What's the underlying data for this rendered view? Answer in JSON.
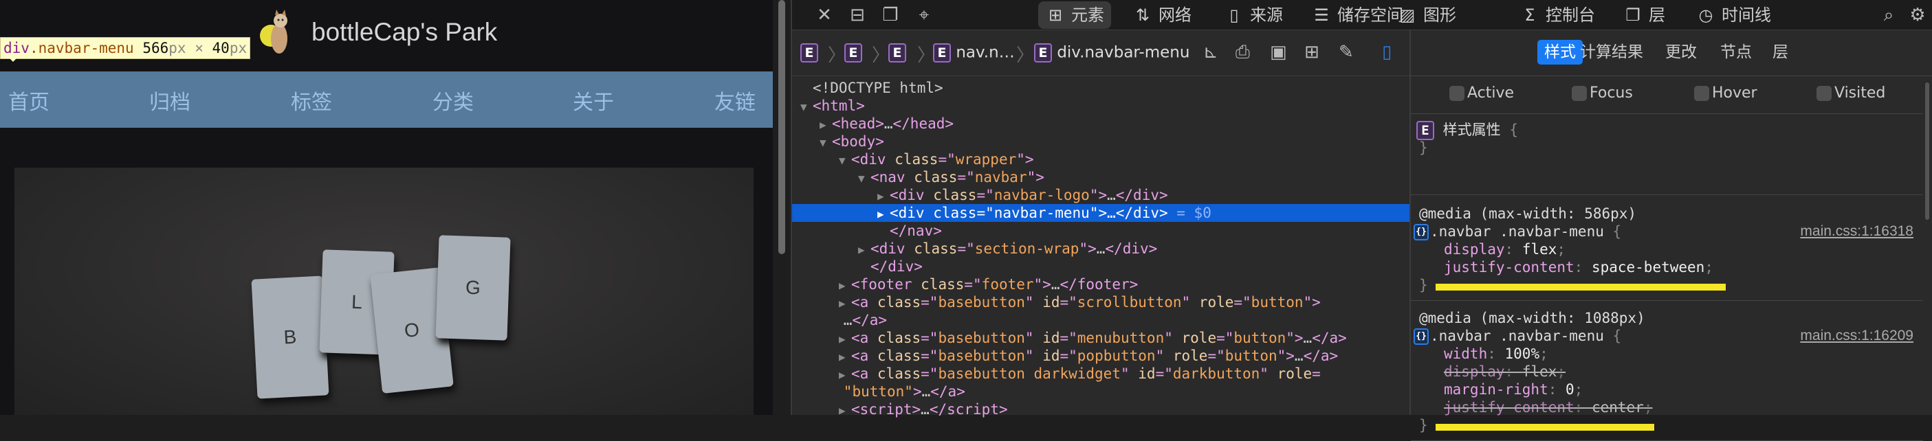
{
  "site": {
    "title": "bottleCap's Park",
    "nav": [
      "首页",
      "归档",
      "标签",
      "分类",
      "关于",
      "友链"
    ],
    "hero_letters": [
      "B",
      "L",
      "O",
      "G"
    ]
  },
  "tooltip": {
    "tag": "div",
    "cls": ".navbar-menu",
    "w": "566",
    "h": "40",
    "unit": "px",
    "times": "×"
  },
  "devtools": {
    "tabs": [
      {
        "label": "元素",
        "icon": "elements-icon"
      },
      {
        "label": "网络",
        "icon": "network-icon"
      },
      {
        "label": "来源",
        "icon": "sources-icon"
      },
      {
        "label": "储存空间",
        "icon": "storage-icon"
      },
      {
        "label": "图形",
        "icon": "graphics-icon"
      },
      {
        "label": "控制台",
        "icon": "console-icon"
      },
      {
        "label": "层",
        "icon": "layers-icon"
      },
      {
        "label": "时间线",
        "icon": "timeline-icon"
      }
    ],
    "active_tab": "元素",
    "breadcrumb": [
      "",
      "",
      "",
      "nav.n…",
      "div.navbar-menu"
    ],
    "dom": [
      [
        0,
        "",
        [
          [
            "t-txt",
            "<!DOCTYPE html>"
          ]
        ]
      ],
      [
        0,
        "▼",
        [
          [
            "t-tag",
            "<html>"
          ]
        ]
      ],
      [
        1,
        "▶",
        [
          [
            "t-tag",
            "<head>"
          ],
          [
            "t-txt",
            "…"
          ],
          [
            "t-tag",
            "</head>"
          ]
        ]
      ],
      [
        1,
        "▼",
        [
          [
            "t-tag",
            "<body>"
          ]
        ]
      ],
      [
        2,
        "▼",
        [
          [
            "t-tag",
            "<div "
          ],
          [
            "t-attr",
            "class"
          ],
          [
            "t-tag",
            "=\""
          ],
          [
            "t-val",
            "wrapper"
          ],
          [
            "t-tag",
            "\">"
          ]
        ]
      ],
      [
        3,
        "▼",
        [
          [
            "t-tag",
            "<nav "
          ],
          [
            "t-attr",
            "class"
          ],
          [
            "t-tag",
            "=\""
          ],
          [
            "t-val",
            "navbar"
          ],
          [
            "t-tag",
            "\">"
          ]
        ]
      ],
      [
        4,
        "▶",
        [
          [
            "t-tag",
            "<div "
          ],
          [
            "t-attr",
            "class"
          ],
          [
            "t-tag",
            "=\""
          ],
          [
            "t-val",
            "navbar-logo"
          ],
          [
            "t-tag",
            "\">"
          ],
          [
            "t-txt",
            "…"
          ],
          [
            "t-tag",
            "</div>"
          ]
        ]
      ],
      [
        4,
        "▶",
        [
          [
            "t-tag",
            "<div "
          ],
          [
            "t-attr",
            "class"
          ],
          [
            "t-tag",
            "=\""
          ],
          [
            "t-val",
            "navbar-menu"
          ],
          [
            "t-tag",
            "\">"
          ],
          [
            "t-txt",
            "…"
          ],
          [
            "t-tag",
            "</div>"
          ],
          [
            "t-dim",
            " = $0"
          ]
        ]
      ],
      [
        4,
        "",
        [
          [
            "t-tag",
            "</nav>"
          ]
        ]
      ],
      [
        3,
        "▶",
        [
          [
            "t-tag",
            "<div "
          ],
          [
            "t-attr",
            "class"
          ],
          [
            "t-tag",
            "=\""
          ],
          [
            "t-val",
            "section-wrap"
          ],
          [
            "t-tag",
            "\">"
          ],
          [
            "t-txt",
            "…"
          ],
          [
            "t-tag",
            "</div>"
          ]
        ]
      ],
      [
        3,
        "",
        [
          [
            "t-tag",
            "</div>"
          ]
        ]
      ],
      [
        2,
        "▶",
        [
          [
            "t-tag",
            "<footer "
          ],
          [
            "t-attr",
            "class"
          ],
          [
            "t-tag",
            "=\""
          ],
          [
            "t-val",
            "footer"
          ],
          [
            "t-tag",
            "\">"
          ],
          [
            "t-txt",
            "…"
          ],
          [
            "t-tag",
            "</footer>"
          ]
        ]
      ],
      [
        2,
        "▶",
        [
          [
            "t-tag",
            "<a "
          ],
          [
            "t-attr",
            "class"
          ],
          [
            "t-tag",
            "=\""
          ],
          [
            "t-val",
            "basebutton"
          ],
          [
            "t-tag",
            "\" "
          ],
          [
            "t-attr",
            "id"
          ],
          [
            "t-tag",
            "=\""
          ],
          [
            "t-val",
            "scrollbutton"
          ],
          [
            "t-tag",
            "\" "
          ],
          [
            "t-attr",
            "role"
          ],
          [
            "t-tag",
            "=\""
          ],
          [
            "t-val",
            "button"
          ],
          [
            "t-tag",
            "\">"
          ]
        ]
      ],
      [
        1.6,
        "",
        [
          [
            "t-txt",
            "…"
          ],
          [
            "t-tag",
            "</a>"
          ]
        ]
      ],
      [
        2,
        "▶",
        [
          [
            "t-tag",
            "<a "
          ],
          [
            "t-attr",
            "class"
          ],
          [
            "t-tag",
            "=\""
          ],
          [
            "t-val",
            "basebutton"
          ],
          [
            "t-tag",
            "\" "
          ],
          [
            "t-attr",
            "id"
          ],
          [
            "t-tag",
            "=\""
          ],
          [
            "t-val",
            "menubutton"
          ],
          [
            "t-tag",
            "\" "
          ],
          [
            "t-attr",
            "role"
          ],
          [
            "t-tag",
            "=\""
          ],
          [
            "t-val",
            "button"
          ],
          [
            "t-tag",
            "\">"
          ],
          [
            "t-txt",
            "…"
          ],
          [
            "t-tag",
            "</a>"
          ]
        ]
      ],
      [
        2,
        "▶",
        [
          [
            "t-tag",
            "<a "
          ],
          [
            "t-attr",
            "class"
          ],
          [
            "t-tag",
            "=\""
          ],
          [
            "t-val",
            "basebutton"
          ],
          [
            "t-tag",
            "\" "
          ],
          [
            "t-attr",
            "id"
          ],
          [
            "t-tag",
            "=\""
          ],
          [
            "t-val",
            "popbutton"
          ],
          [
            "t-tag",
            "\" "
          ],
          [
            "t-attr",
            "role"
          ],
          [
            "t-tag",
            "=\""
          ],
          [
            "t-val",
            "button"
          ],
          [
            "t-tag",
            "\">"
          ],
          [
            "t-txt",
            "…"
          ],
          [
            "t-tag",
            "</a>"
          ]
        ]
      ],
      [
        2,
        "▶",
        [
          [
            "t-tag",
            "<a "
          ],
          [
            "t-attr",
            "class"
          ],
          [
            "t-tag",
            "=\""
          ],
          [
            "t-val",
            "basebutton darkwidget"
          ],
          [
            "t-tag",
            "\" "
          ],
          [
            "t-attr",
            "id"
          ],
          [
            "t-tag",
            "=\""
          ],
          [
            "t-val",
            "darkbutton"
          ],
          [
            "t-tag",
            "\" "
          ],
          [
            "t-attr",
            "role"
          ],
          [
            "t-tag",
            "="
          ]
        ]
      ],
      [
        1.6,
        "",
        [
          [
            "t-val",
            "\"button\""
          ],
          [
            "t-tag",
            ">"
          ],
          [
            "t-txt",
            "…"
          ],
          [
            "t-tag",
            "</a>"
          ]
        ]
      ],
      [
        2,
        "▶",
        [
          [
            "t-tag",
            "<script>"
          ],
          [
            "t-txt",
            "…"
          ],
          [
            "t-tag",
            "</script>"
          ]
        ]
      ]
    ],
    "selected_index": 7,
    "sidebar": {
      "tabs": [
        "样式",
        "计算结果",
        "更改",
        "节点",
        "层"
      ],
      "pseudo": [
        "Active",
        "Focus",
        "Hover",
        "Visited"
      ],
      "style_attr": "样式属性",
      "rules": [
        {
          "media": "@media (max-width: 586px)",
          "selector": ".navbar .navbar-menu",
          "source": "main.css:1:16318",
          "props": [
            {
              "n": "display",
              "v": "flex",
              "off": false
            },
            {
              "n": "justify-content",
              "v": "space-between",
              "off": false
            }
          ]
        },
        {
          "media": "@media (max-width: 1088px)",
          "selector": ".navbar .navbar-menu",
          "source": "main.css:1:16209",
          "props": [
            {
              "n": "width",
              "v": "100%",
              "off": false
            },
            {
              "n": "display",
              "v": "flex",
              "off": true
            },
            {
              "n": "margin-right",
              "v": "0",
              "off": false
            },
            {
              "n": "justify-content",
              "v": "center",
              "off": true
            }
          ]
        }
      ]
    }
  },
  "colors": {
    "navbar": "#557a9c",
    "selection": "#0f5fd6",
    "accent": "#1a7cf5",
    "highlight": "#f5e626"
  }
}
